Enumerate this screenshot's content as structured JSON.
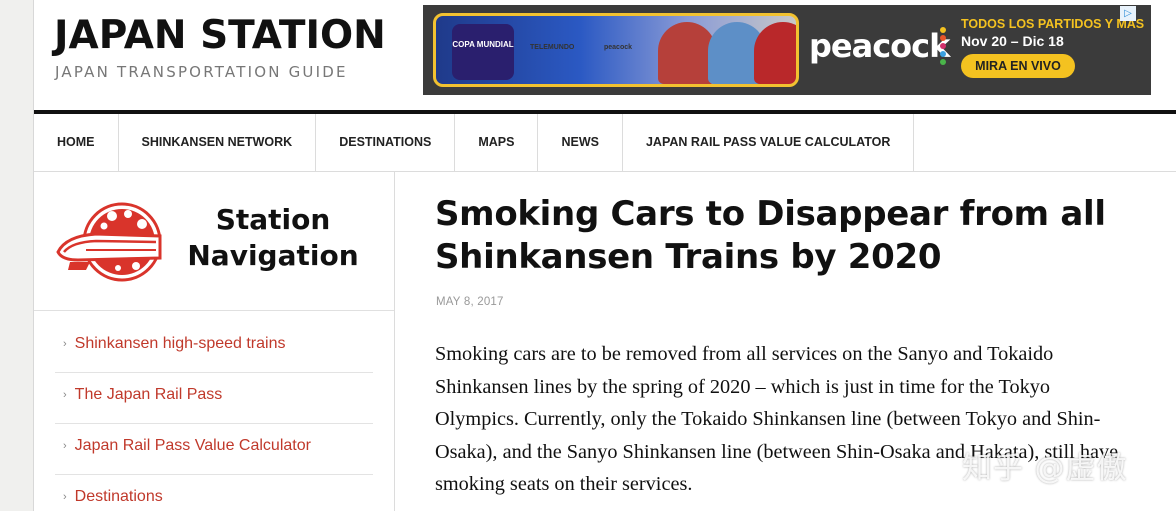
{
  "site": {
    "title": "JAPAN STATION",
    "tagline": "JAPAN TRANSPORTATION GUIDE"
  },
  "ad": {
    "copa_label": "COPA MUNDIAL",
    "partner_1": "TELEMUNDO",
    "partner_2": "peacock",
    "brand": "peacock",
    "line1": "TODOS LOS PARTIDOS Y MÁS",
    "line2": "Nov 20 – Dic 18",
    "cta": "MIRA EN VIVO",
    "choices_icon": "adchoices-icon",
    "colors": {
      "accent": "#f4c220",
      "background": "#3b3b3b"
    }
  },
  "nav": {
    "items": [
      {
        "label": "HOME"
      },
      {
        "label": "SHINKANSEN NETWORK"
      },
      {
        "label": "DESTINATIONS"
      },
      {
        "label": "MAPS"
      },
      {
        "label": "NEWS"
      },
      {
        "label": "JAPAN RAIL PASS VALUE CALCULATOR"
      }
    ]
  },
  "sidebar": {
    "title": "Station Navigation",
    "logo_icon": "shinkansen-logo-icon",
    "items": [
      {
        "label": "Shinkansen high-speed trains"
      },
      {
        "label": "The Japan Rail Pass"
      },
      {
        "label": "Japan Rail Pass Value Calculator"
      },
      {
        "label": "Destinations"
      }
    ],
    "link_color": "#c0392b"
  },
  "article": {
    "title": "Smoking Cars to Disappear from all Shinkansen Trains by 2020",
    "date": "MAY 8, 2017",
    "body": "Smoking cars are to be removed from all services on the Sanyo and Tokaido Shinkansen lines by the spring of 2020 – which is just in time for the Tokyo Olympics. Currently, only the Tokaido Shinkansen line (between Tokyo and Shin-Osaka), and the Sanyo Shinkansen line (between Shin-Osaka and Hakata), still have smoking seats on their services."
  },
  "watermark": "知乎 @虚傲"
}
